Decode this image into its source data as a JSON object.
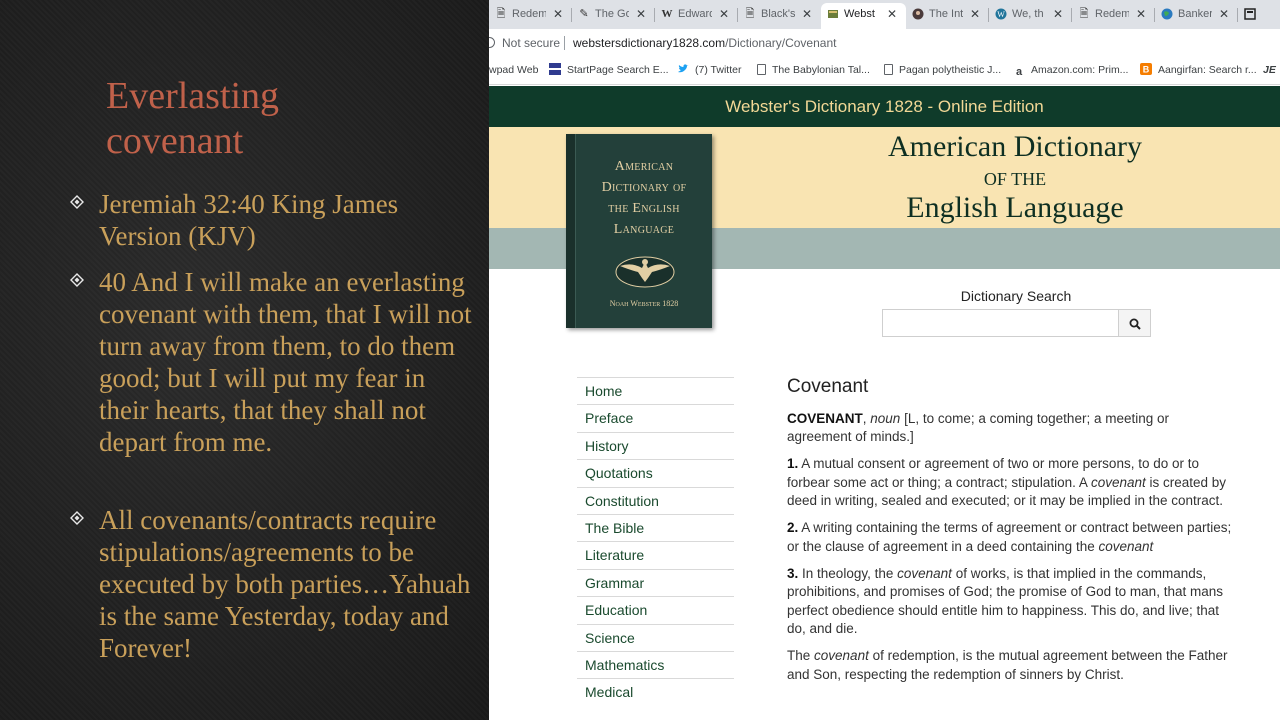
{
  "slide": {
    "title_line1": "Everlasting",
    "title_line2": "covenant",
    "bullets": [
      "Jeremiah 32:40 King James Version (KJV)",
      "40 And I will make an everlasting covenant with them, that I will not turn away from them, to do them good; but I will put my fear in their hearts, that they shall not depart from me.",
      "All covenants/contracts require stipulations/agreements to be executed by both parties…Yahuah is the same Yesterday, today and Forever!"
    ]
  },
  "browser": {
    "tabs": [
      {
        "label": "Redem",
        "icon": "document-icon"
      },
      {
        "label": "The Go",
        "icon": "quill-icon"
      },
      {
        "label": "Edward",
        "icon": "wikipedia-icon"
      },
      {
        "label": "Black's",
        "icon": "document-icon"
      },
      {
        "label": "Webst",
        "icon": "book-icon",
        "active": true
      },
      {
        "label": "The Int",
        "icon": "circle-icon"
      },
      {
        "label": "We, th",
        "icon": "wordpress-icon"
      },
      {
        "label": "Redem",
        "icon": "document-icon"
      },
      {
        "label": "Banker",
        "icon": "globe-icon"
      }
    ],
    "omnibox": {
      "security": "Not secure",
      "url_domain": "webstersdictionary1828.com",
      "url_path": "/Dictionary/Covenant"
    },
    "bookmarks": [
      {
        "label": "wpad Web",
        "icon": "none"
      },
      {
        "label": "StartPage Search E...",
        "icon": "startpage-icon"
      },
      {
        "label": "(7) Twitter",
        "icon": "twitter-icon"
      },
      {
        "label": "The Babylonian Tal...",
        "icon": "document-icon"
      },
      {
        "label": "Pagan polytheistic J...",
        "icon": "document-icon"
      },
      {
        "label": "Amazon.com: Prim...",
        "icon": "amazon-icon"
      },
      {
        "label": "Aangirfan: Search r...",
        "icon": "blogger-icon"
      },
      {
        "label": "JE",
        "icon": "none"
      }
    ],
    "colors": {
      "site_green": "#0f3b2a",
      "site_gold": "#f2d896",
      "cream": "#f9e4b2",
      "sage": "#a3b7b3",
      "slide_title": "#c0614a",
      "slide_text": "#c9a05a"
    }
  },
  "site": {
    "banner": "Webster's Dictionary 1828 - Online Edition",
    "header_line1": "American Dictionary",
    "header_line2": "OF THE",
    "header_line3": "English Language",
    "book_title_1": "American",
    "book_title_2": "Dictionary of",
    "book_title_3": "the English",
    "book_title_4": "Language",
    "book_author": "Noah Webster 1828",
    "search_label": "Dictionary Search",
    "search_value": "",
    "nav": [
      "Home",
      "Preface",
      "History",
      "Quotations",
      "Constitution",
      "The Bible",
      "Literature",
      "Grammar",
      "Education",
      "Science",
      "Mathematics",
      "Medical"
    ]
  },
  "entry": {
    "word": "Covenant",
    "headword": "COVENANT",
    "pos": "noun",
    "etymology": "[L, to come; a coming together; a meeting or agreement of minds.]",
    "def1_num": "1.",
    "def1_a": "A mutual consent or agreement of two or more persons, to do or to forbear some act or thing; a contract; stipulation. A",
    "def1_em": "covenant",
    "def1_b": "is created by deed in writing, sealed and executed; or it may be implied in the contract.",
    "def2_num": "2.",
    "def2_a": "A writing containing the terms of agreement or contract between parties; or the clause of agreement in a deed containing the",
    "def2_em": "covenant",
    "def3_num": "3.",
    "def3_a": "In theology, the",
    "def3_em": "covenant",
    "def3_b": "of works, is that implied in the commands, prohibitions, and promises of God; the promise of God to man, that mans perfect obedience should entitle him to happiness. This do, and live; that do, and die.",
    "def4_a": "The",
    "def4_em": "covenant",
    "def4_b": "of redemption, is the mutual agreement between the Father and Son, respecting the redemption of sinners by Christ."
  }
}
